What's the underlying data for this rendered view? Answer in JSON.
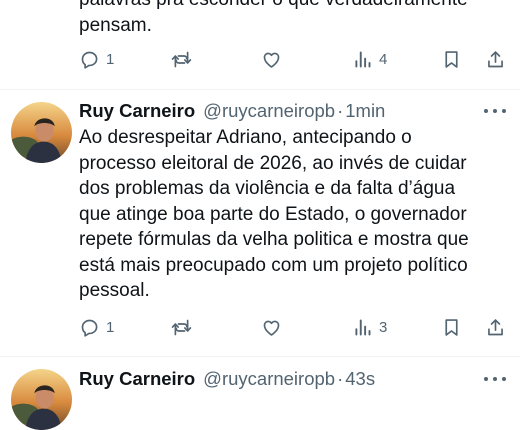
{
  "previous_tweet": {
    "text_lines": [
      "palavras pra esconder o que verdadeiramente",
      "pensam."
    ],
    "replies": "1",
    "retweets": "",
    "likes": "",
    "views": "4"
  },
  "tweet": {
    "author_name": "Ruy Carneiro",
    "handle": "@ruycarneiropb",
    "separator": "·",
    "time": "1min",
    "text_lines": [
      "Ao desrespeitar Adriano, antecipando o",
      "processo eleitoral de 2026, ao invés de cuidar",
      "dos problemas da violência e da falta d’água",
      "que atinge boa parte do Estado, o governador",
      "repete fórmulas da velha politica e mostra que",
      "está mais preocupado com um projeto político",
      "pessoal."
    ],
    "replies": "1",
    "retweets": "",
    "likes": "",
    "views": "3"
  },
  "next_tweet": {
    "author_name": "Ruy Carneiro",
    "handle": "@ruycarneiropb",
    "separator": "·",
    "time": "43s"
  },
  "icons": [
    "reply-icon",
    "retweet-icon",
    "like-icon",
    "views-icon",
    "bookmark-icon",
    "share-icon",
    "more-icon"
  ],
  "colors": {
    "text": "#0f1419",
    "secondary": "#536471",
    "divider": "#eff3f4",
    "background": "#ffffff"
  }
}
